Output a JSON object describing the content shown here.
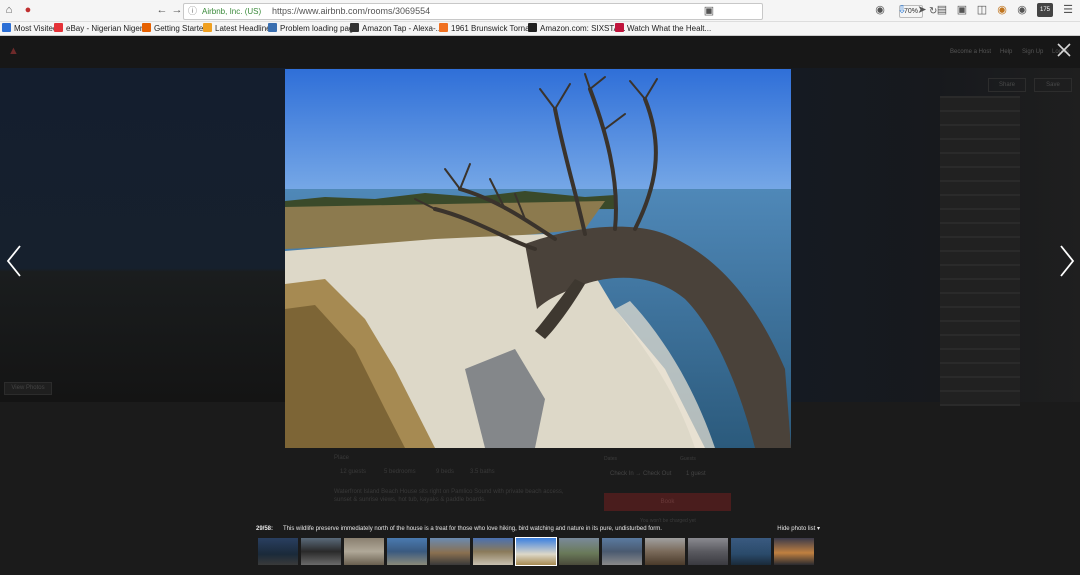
{
  "browser": {
    "site_identity": "Airbnb, Inc. (US)",
    "url": "https://www.airbnb.com/rooms/3069554",
    "zoom": "70%",
    "notification_count": "175"
  },
  "bookmarks": [
    {
      "label": "Most Visited",
      "color": "#2b6fd6"
    },
    {
      "label": "eBay - Nigerian Nigeri...",
      "color": "#e53238"
    },
    {
      "label": "Getting Started",
      "color": "#e66000"
    },
    {
      "label": "Latest Headlines",
      "color": "#f0a020"
    },
    {
      "label": "Problem loading page",
      "color": "#3a6fb0"
    },
    {
      "label": "Amazon Tap - Alexa-...",
      "color": "#333333"
    },
    {
      "label": "1961 Brunswick Torna...",
      "color": "#f07020"
    },
    {
      "label": "Amazon.com: SIXSTA...",
      "color": "#222222"
    },
    {
      "label": "Watch What the Healt...",
      "color": "#c0143c"
    }
  ],
  "page": {
    "header_links": [
      "Become a Host",
      "Help",
      "Sign Up",
      "Log In"
    ],
    "share_label": "Share",
    "save_label": "Save",
    "view_photos_label": "View Photos",
    "info_heading": "Place",
    "stats": [
      "12 guests",
      "5 bedrooms",
      "9 beds",
      "3.5 baths"
    ],
    "description": "Waterfront Island Beach House sits right on Pamlico Sound with private beach access, sunset & sunrise views, hot tub, kayaks & paddle boards.",
    "book_label": "Book",
    "checkin_label": "Dates",
    "checkin_value": "Check In → Check Out",
    "guests_label": "Guests",
    "guests_value": "1 guest",
    "book_note": "You won't be charged yet"
  },
  "lightbox": {
    "photo_index": "29/58:",
    "caption": "This wildlife preserve immediately north of the house is a treat for those who love hiking, bird watching and nature in its pure, undisturbed form.",
    "hide_list_label": "Hide photo list",
    "active_thumb": 6,
    "thumbnails": [
      "dock-at-dusk",
      "beach-chairs",
      "shells-on-table",
      "sound-view",
      "marsh-sunset",
      "driftwood-beach",
      "driftwood-tree",
      "grassy-shore",
      "pier-view",
      "room-interior",
      "group-photo",
      "water-horizon",
      "sunset-sound"
    ]
  },
  "colors": {
    "sky": "#3a7fe0",
    "water": "#3c6f9a",
    "sand": "#ddd8c8",
    "grass": "#a68a52",
    "driftwood": "#4a423a"
  }
}
